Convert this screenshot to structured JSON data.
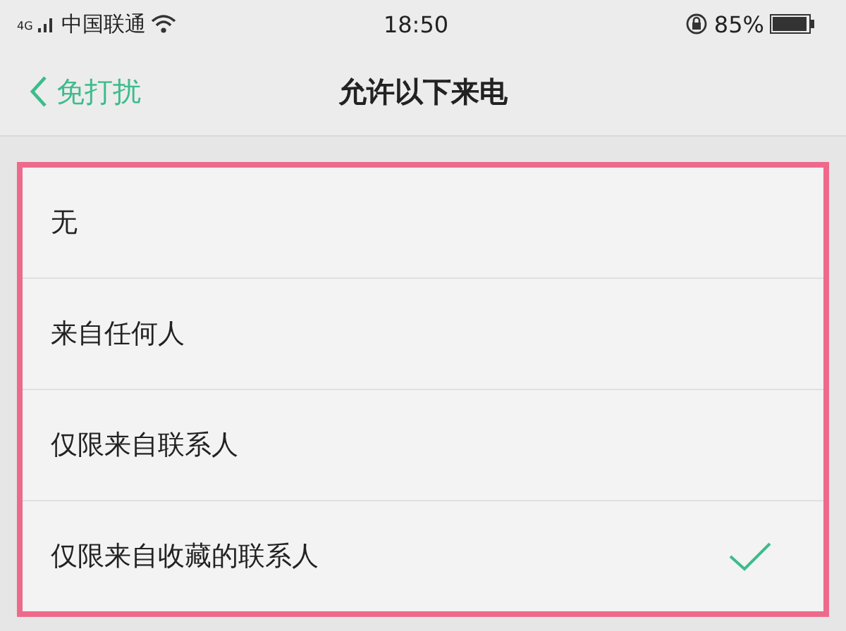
{
  "status_bar": {
    "network": "4G",
    "carrier": "中国联通",
    "time": "18:50",
    "battery": "85%"
  },
  "nav": {
    "back_label": "免打扰",
    "title": "允许以下来电"
  },
  "options": [
    {
      "label": "无",
      "selected": false
    },
    {
      "label": "来自任何人",
      "selected": false
    },
    {
      "label": "仅限来自联系人",
      "selected": false
    },
    {
      "label": "仅限来自收藏的联系人",
      "selected": true
    }
  ]
}
